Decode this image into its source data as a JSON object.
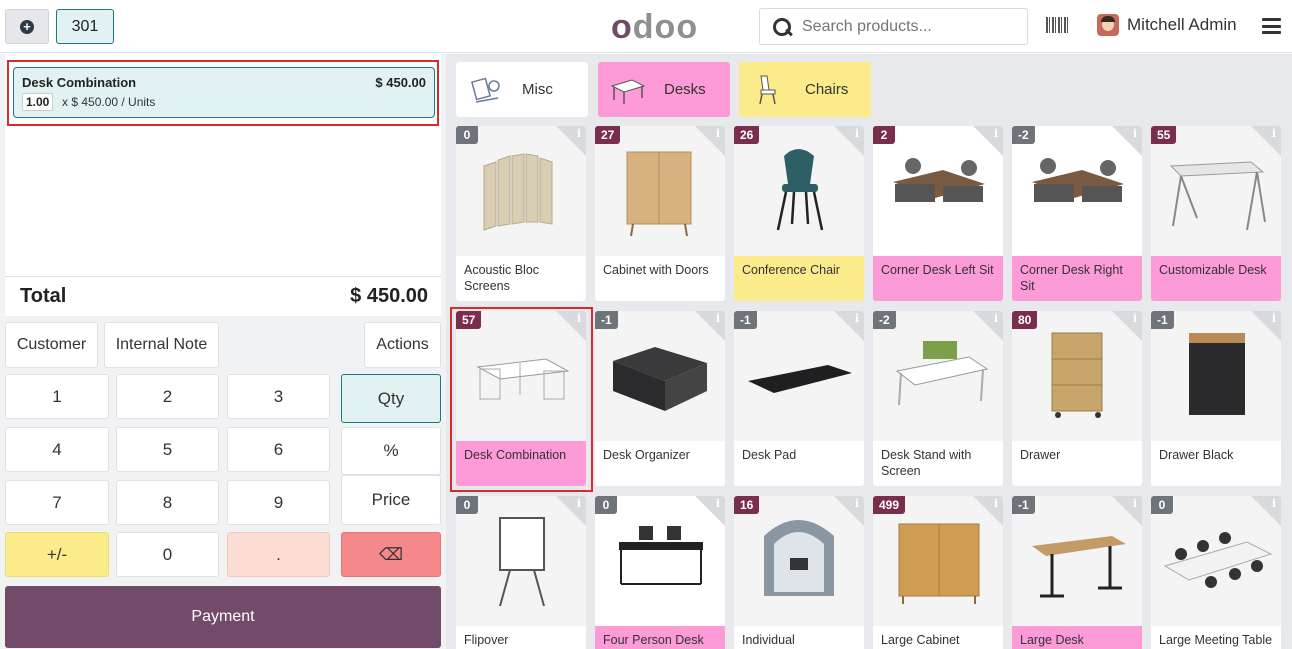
{
  "header": {
    "new_order_icon": "plus-circle-icon",
    "order_number": "301",
    "logo": "odoo",
    "search_placeholder": "Search products...",
    "user_name": "Mitchell Admin"
  },
  "order": {
    "lines": [
      {
        "name": "Desk Combination",
        "price": "$ 450.00",
        "qty": "1.00",
        "detail": "x $ 450.00 / Units"
      }
    ],
    "total_label": "Total",
    "total_value": "$ 450.00"
  },
  "controls": {
    "customer": "Customer",
    "internal_note": "Internal Note",
    "actions": "Actions"
  },
  "numpad": {
    "k1": "1",
    "k2": "2",
    "k3": "3",
    "k4": "4",
    "k5": "5",
    "k6": "6",
    "k7": "7",
    "k8": "8",
    "k9": "9",
    "plusminus": "+/-",
    "k0": "0",
    "dot": ".",
    "backspace": "⌫",
    "qty": "Qty",
    "percent": "%",
    "price": "Price",
    "payment": "Payment"
  },
  "categories": [
    {
      "name": "Misc",
      "color": "#ffffff"
    },
    {
      "name": "Desks",
      "color": "#fd9ad8"
    },
    {
      "name": "Chairs",
      "color": "#fbeb8b"
    }
  ],
  "products": [
    {
      "name": "Acoustic Bloc Screens",
      "stock": "0"
    },
    {
      "name": "Cabinet with Doors",
      "stock": "27"
    },
    {
      "name": "Conference Chair",
      "stock": "26"
    },
    {
      "name": "Corner Desk Left Sit",
      "stock": "2"
    },
    {
      "name": "Corner Desk Right Sit",
      "stock": "-2"
    },
    {
      "name": "Customizable Desk",
      "stock": "55"
    },
    {
      "name": "Desk Combination",
      "stock": "57"
    },
    {
      "name": "Desk Organizer",
      "stock": "-1"
    },
    {
      "name": "Desk Pad",
      "stock": "-1"
    },
    {
      "name": "Desk Stand with Screen",
      "stock": "-2"
    },
    {
      "name": "Drawer",
      "stock": "80"
    },
    {
      "name": "Drawer Black",
      "stock": "-1"
    },
    {
      "name": "Flipover",
      "stock": "0"
    },
    {
      "name": "Four Person Desk",
      "stock": "0"
    },
    {
      "name": "Individual",
      "stock": "16"
    },
    {
      "name": "Large Cabinet",
      "stock": "499"
    },
    {
      "name": "Large Desk",
      "stock": "-1"
    },
    {
      "name": "Large Meeting Table",
      "stock": "0"
    }
  ]
}
